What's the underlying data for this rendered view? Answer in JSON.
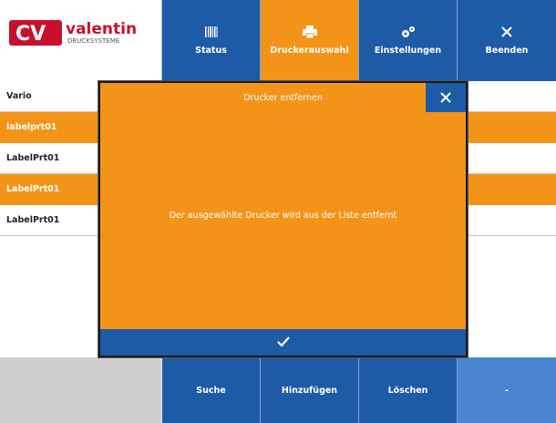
{
  "logo": {
    "brand": "valentin",
    "sub": "DRUCKSYSTEME",
    "mark": "CV",
    "color_red": "#c8102e",
    "color_text": "#c8102e"
  },
  "nav": [
    {
      "label": "Status",
      "icon": "barcode-icon"
    },
    {
      "label": "Druckerauswahl",
      "icon": "printer-icon",
      "active": true
    },
    {
      "label": "Einstellungen",
      "icon": "gears-icon"
    },
    {
      "label": "Beenden",
      "icon": "close-icon"
    }
  ],
  "list": {
    "rows": [
      {
        "label": "Vario",
        "highlight": false
      },
      {
        "label": "labelprt01",
        "highlight": true
      },
      {
        "label": "LabelPrt01",
        "highlight": false
      },
      {
        "label": "LabelPrt01",
        "highlight": true
      },
      {
        "label": "LabelPrt01",
        "highlight": false
      }
    ]
  },
  "footer": {
    "buttons": [
      {
        "label": "Suche"
      },
      {
        "label": "Hinzufügen"
      },
      {
        "label": "Löschen"
      },
      {
        "label": "-"
      }
    ]
  },
  "modal": {
    "title": "Drucker entfernen",
    "message": "Der ausgewählte Drucker wird aus der Liste entfernt",
    "ok_icon": "checkmark-icon"
  },
  "colors": {
    "blue": "#1d5ba6",
    "orange": "#f39419",
    "light_blue": "#4a86cf",
    "grey": "#cfcfcf"
  }
}
